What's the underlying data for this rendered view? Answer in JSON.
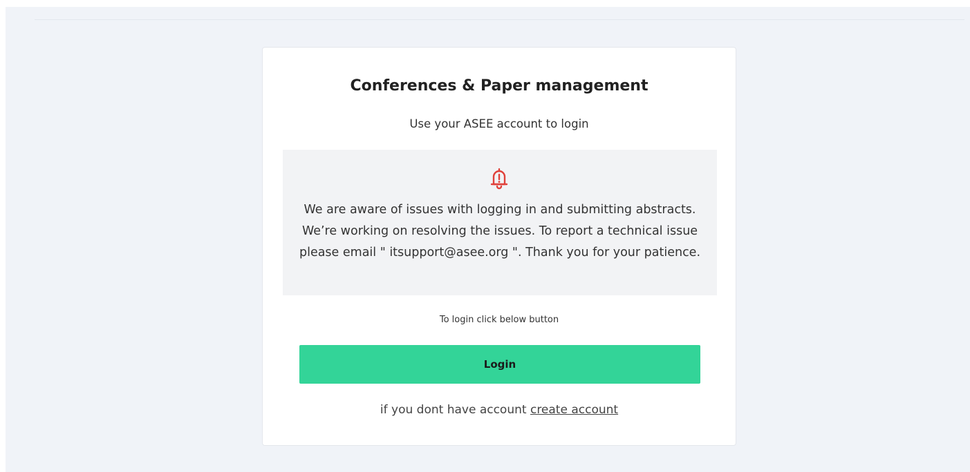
{
  "card": {
    "title": "Conferences & Paper management",
    "subtitle": "Use your ASEE account to login"
  },
  "notice": {
    "icon": "bell-alert-icon",
    "icon_color": "#e0413b",
    "text": "We are aware of issues with logging in and submitting abstracts. We’re working on resolving the issues. To report a technical issue please email \" itsupport@asee.org \". Thank you for your patience."
  },
  "login": {
    "hint": "To login click below button",
    "button_label": "Login",
    "button_color": "#33d498"
  },
  "signup": {
    "prompt": "if you dont have account",
    "link_label": "create account"
  }
}
